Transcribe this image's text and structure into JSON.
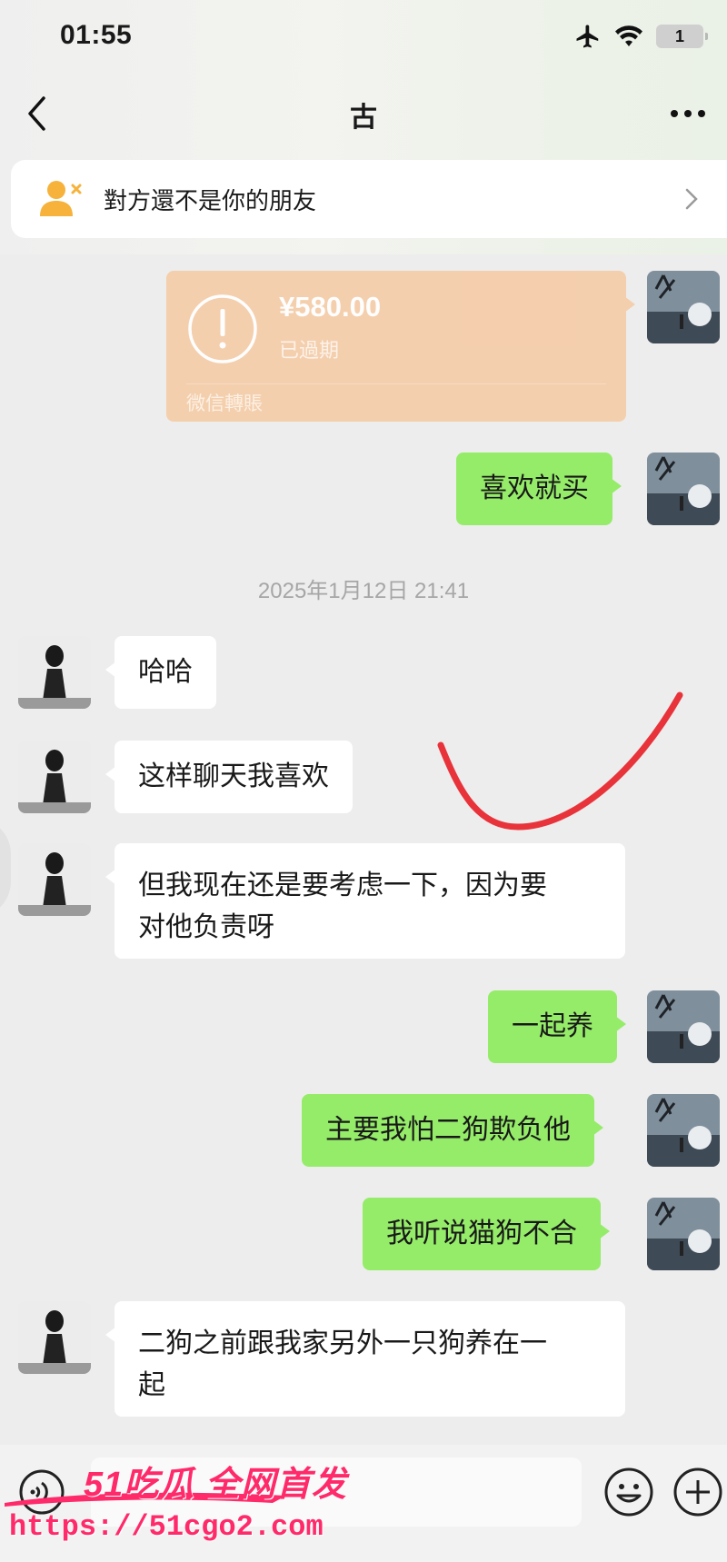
{
  "status_bar": {
    "time": "01:55",
    "battery": "1"
  },
  "nav": {
    "title": "古"
  },
  "friend_banner": {
    "text": "對方還不是你的朋友"
  },
  "transfer": {
    "amount": "¥580.00",
    "status": "已過期",
    "label": "微信轉賬"
  },
  "timestamp": "2025年1月12日 21:41",
  "messages": [
    {
      "side": "me",
      "text": "喜欢就买"
    },
    {
      "side": "them",
      "text": "哈哈"
    },
    {
      "side": "them",
      "text": "这样聊天我喜欢"
    },
    {
      "side": "them",
      "lines": [
        "但我现在还是要考虑一下，因为要",
        "对他负责呀"
      ]
    },
    {
      "side": "me",
      "text": "一起养"
    },
    {
      "side": "me",
      "text": "主要我怕二狗欺负他"
    },
    {
      "side": "me",
      "text": "我听说猫狗不合"
    },
    {
      "side": "them",
      "lines": [
        "二狗之前跟我家另外一只狗养在一",
        "起"
      ]
    }
  ],
  "watermark": {
    "title": "51吃瓜 全网首发",
    "url": "https://51cgo2.com"
  },
  "colors": {
    "my_bubble": "#95ec69",
    "their_bubble": "#ffffff",
    "transfer": "#f5ceaa",
    "annotation": "#e8333b",
    "watermark": "#ff2a6a"
  },
  "icons": [
    "back-arrow-icon",
    "more-icon",
    "add-friend-icon",
    "chevron-right-icon",
    "airplane-icon",
    "wifi-icon",
    "warning-icon",
    "voice-icon",
    "emoji-icon",
    "plus-icon"
  ]
}
